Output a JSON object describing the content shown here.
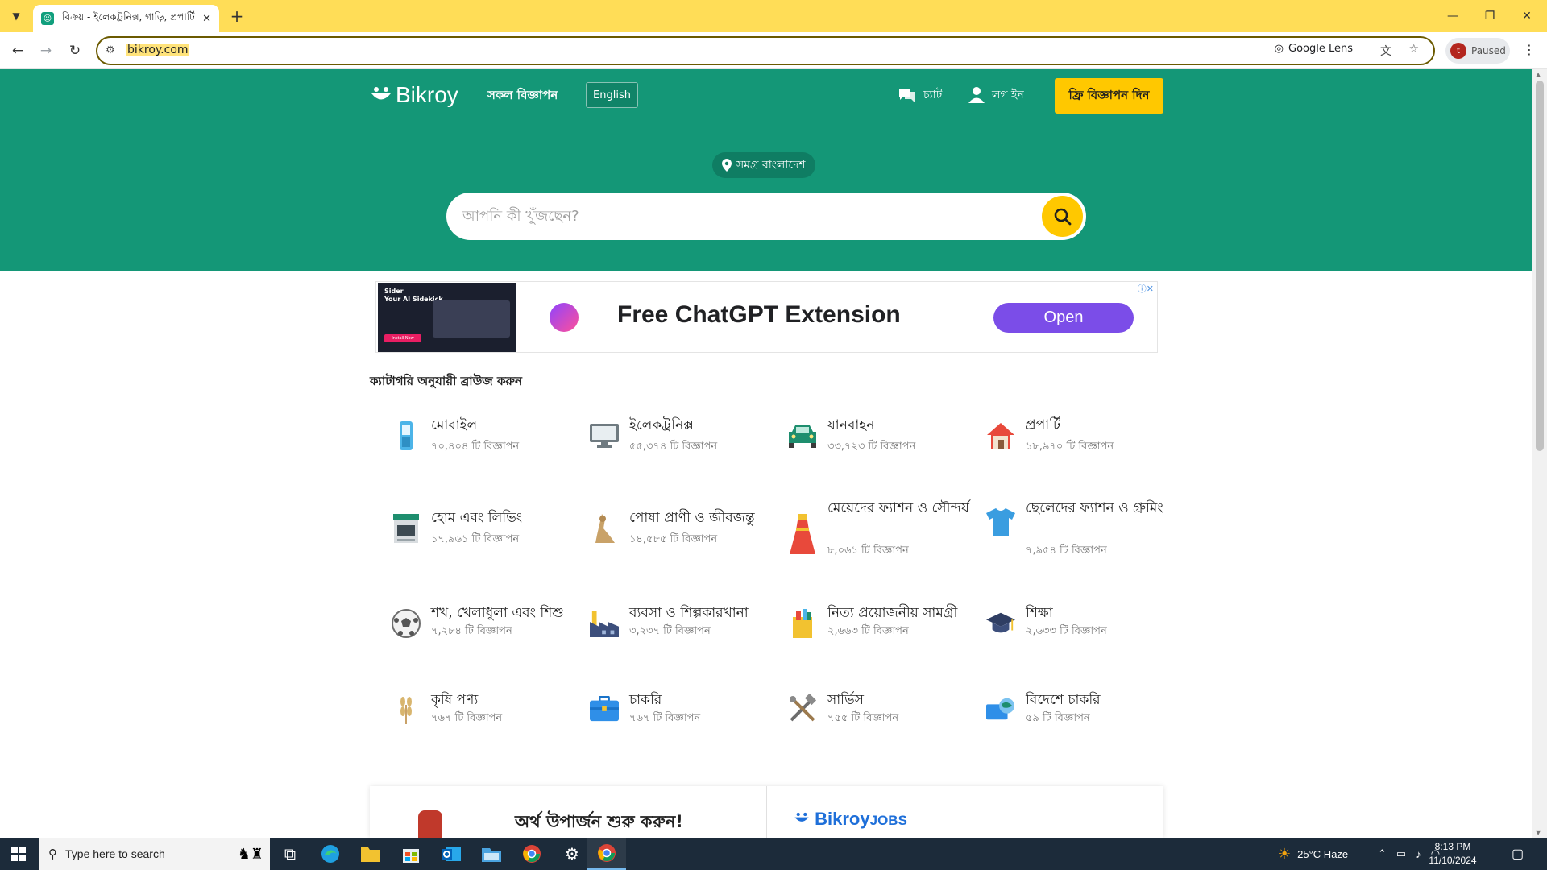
{
  "browser": {
    "tab_title": "বিক্রয় - ইলেকট্রনিক্স, গাড়ি, প্রপার্টি",
    "url": "bikroy.com",
    "lens_label": "Google Lens",
    "profile_label": "Paused",
    "profile_initial": "t"
  },
  "header": {
    "logo_text": "Bikroy",
    "all_ads": "সকল বিজ্ঞাপন",
    "language_button": "English",
    "chat": "চ্যাট",
    "login": "লগ ইন",
    "post_ad": "ফ্রি বিজ্ঞাপন দিন",
    "location": "সমগ্র বাংলাদেশ",
    "search_placeholder": "আপনি কী খুঁজছেন?"
  },
  "ad_banner": {
    "thumb_title": "Sider\nYour AI Sidekick",
    "thumb_button": "Install Now",
    "headline": "Free ChatGPT Extension",
    "cta": "Open"
  },
  "categories": {
    "title": "ক্যাটাগরি অনুযায়ী ব্রাউজ করুন",
    "items": [
      {
        "name": "মোবাইল",
        "count": "৭০,৪০৪ টি বিজ্ঞাপন",
        "icon": "mobile-phone-icon"
      },
      {
        "name": "ইলেকট্রনিক্স",
        "count": "৫৫,৩৭৪ টি বিজ্ঞাপন",
        "icon": "monitor-icon"
      },
      {
        "name": "যানবাহন",
        "count": "৩৩,৭২৩ টি বিজ্ঞাপন",
        "icon": "car-icon"
      },
      {
        "name": "প্রপার্টি",
        "count": "১৮,৯৭০ টি বিজ্ঞাপন",
        "icon": "house-icon"
      },
      {
        "name": "হোম এবং লিভিং",
        "count": "১৭,৯৬১ টি বিজ্ঞাপন",
        "icon": "kitchen-stove-icon"
      },
      {
        "name": "পোষা প্রাণী ও জীবজন্তু",
        "count": "১৪,৫৮৫ টি বিজ্ঞাপন",
        "icon": "cat-icon"
      },
      {
        "name": "মেয়েদের ফ্যাশন ও সৌন্দর্য",
        "count": "৮,০৬১ টি বিজ্ঞাপন",
        "icon": "dress-icon"
      },
      {
        "name": "ছেলেদের ফ্যাশন ও গ্রুমিং",
        "count": "৭,৯৫৪ টি বিজ্ঞাপন",
        "icon": "tshirt-icon"
      },
      {
        "name": "শখ, খেলাধুলা এবং শিশু",
        "count": "৭,২৮৪ টি বিজ্ঞাপন",
        "icon": "football-icon"
      },
      {
        "name": "ব্যবসা ও শিল্পকারখানা",
        "count": "৩,২৩৭ টি বিজ্ঞাপন",
        "icon": "factory-icon"
      },
      {
        "name": "নিত্য প্রয়োজনীয় সামগ্রী",
        "count": "২,৬৬৩ টি বিজ্ঞাপন",
        "icon": "grocery-bag-icon"
      },
      {
        "name": "শিক্ষা",
        "count": "২,৬৩৩ টি বিজ্ঞাপন",
        "icon": "graduation-cap-icon"
      },
      {
        "name": "কৃষি পণ্য",
        "count": "৭৬৭ টি বিজ্ঞাপন",
        "icon": "wheat-icon"
      },
      {
        "name": "চাকরি",
        "count": "৭৬৭ টি বিজ্ঞাপন",
        "icon": "briefcase-icon"
      },
      {
        "name": "সার্ভিস",
        "count": "৭৫৫ টি বিজ্ঞাপন",
        "icon": "tools-icon"
      },
      {
        "name": "বিদেশে চাকরি",
        "count": "৫৯ টি বিজ্ঞাপন",
        "icon": "globe-briefcase-icon"
      }
    ]
  },
  "promo": {
    "earn_text": "অর্থ উপার্জন শুরু করুন!",
    "jobs_logo_main": "Bikroy",
    "jobs_logo_suffix": "JOBS"
  },
  "taskbar": {
    "search_placeholder": "Type here to search",
    "weather": "25°C  Haze",
    "time": "8:13 PM",
    "date": "11/10/2024"
  },
  "colors": {
    "brand_green": "#149777",
    "brand_yellow": "#ffc800",
    "browser_frame": "#ffdd57"
  }
}
